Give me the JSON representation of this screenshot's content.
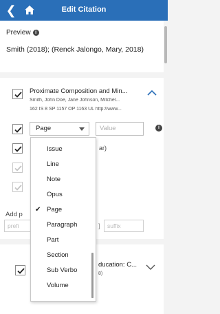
{
  "header": {
    "title": "Edit Citation",
    "back_icon": "chevron-left-icon",
    "home_icon": "home-icon",
    "background": "#2a6fb8"
  },
  "preview": {
    "label": "Preview",
    "text": "Smith (2018); (Renck Jalongo, Mary, 2018)"
  },
  "sources": [
    {
      "title": "Proximate Composition and Min...",
      "authors": "Smith, John Doe, Jane Johnson, Mitchel...",
      "locator": "162 IS 8 SP 1157 OP 1163 UL http://www...",
      "checked": true,
      "expanded": true
    },
    {
      "title": "ducation: C...",
      "subtitle": "8)",
      "checked": true,
      "expanded": false
    }
  ],
  "locator": {
    "selected": "Page",
    "value_placeholder": "Value"
  },
  "partial_texts": {
    "year_fragment": "ar)",
    "add_label": "Add p",
    "prefix_placeholder": "prefi",
    "bracket_fragment": "]",
    "suffix_placeholder": "suffix"
  },
  "dropdown": {
    "options": [
      "Issue",
      "Line",
      "Note",
      "Opus",
      "Page",
      "Paragraph",
      "Part",
      "Section",
      "Sub Verbo",
      "Volume"
    ],
    "selected": "Page"
  }
}
